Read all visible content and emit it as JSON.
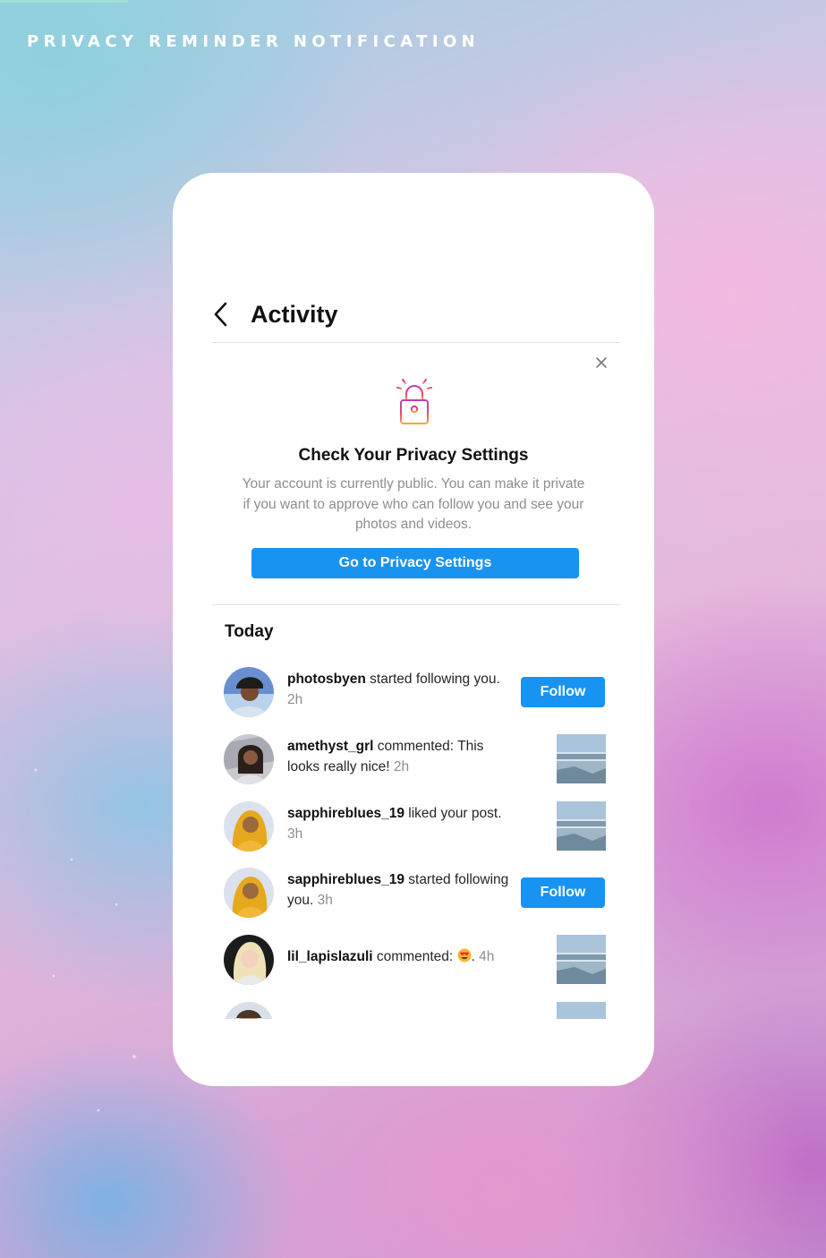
{
  "page": {
    "heading": "PRIVACY REMINDER NOTIFICATION"
  },
  "header": {
    "back_icon": "chevron-left-icon",
    "title": "Activity"
  },
  "privacy_card": {
    "close_icon": "close-icon",
    "lock_icon": "lock-icon",
    "title": "Check Your Privacy Settings",
    "body": "Your account is currently public. You can make it private if you want to approve who can follow you and see your photos and videos.",
    "button_label": "Go to Privacy Settings"
  },
  "activity": {
    "section_title": "Today",
    "items": [
      {
        "username": "photosbyen",
        "text": " started following you.",
        "time": "2h",
        "action": "Follow"
      },
      {
        "username": "amethyst_grl",
        "text": " commented: This looks really nice!",
        "time": "2h"
      },
      {
        "username": "sapphireblues_19",
        "text": " liked your post.",
        "time": "3h"
      },
      {
        "username": "sapphireblues_19",
        "text": " started following you.",
        "time": "3h",
        "action": "Follow"
      },
      {
        "username": "lil_lapislazuli",
        "text": " commented: ",
        "emoji": "heart-eyes-emoji",
        "suffix": ".",
        "time": "4h"
      }
    ]
  },
  "colors": {
    "accent": "#1893f2",
    "muted_text": "#8e8e8e"
  }
}
